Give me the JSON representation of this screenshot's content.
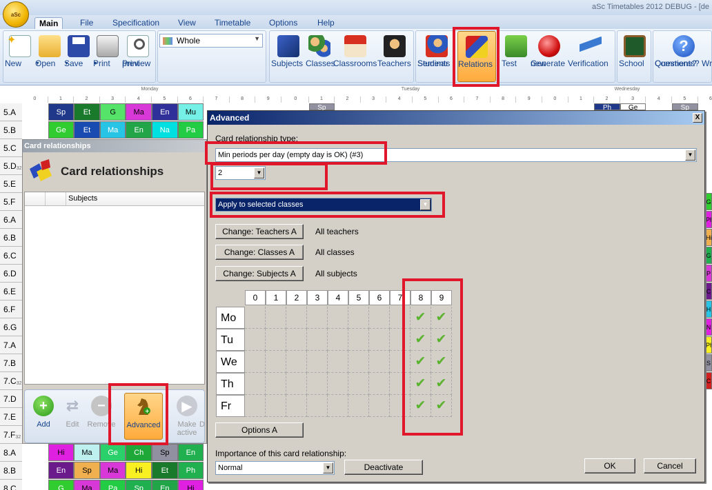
{
  "app": {
    "title": "aSc Timetables 2012  DEBUG - [de",
    "orb_label": "aSc"
  },
  "menu": [
    "Main",
    "File",
    "Specification",
    "View",
    "Timetable",
    "Options",
    "Help"
  ],
  "ribbon": {
    "new": "New",
    "open": "Open",
    "save": "Save",
    "print": "Print",
    "print_preview": [
      "Print",
      "preview"
    ],
    "view_value": "Whole",
    "subjects": "Subjects",
    "classes": "Classes",
    "classrooms": "Classrooms",
    "teachers": "Teachers",
    "students": [
      "Students",
      "Seminar"
    ],
    "relations": "Relations",
    "test": "Test",
    "generate": [
      "Generate",
      "new"
    ],
    "verification": "Verification",
    "school": "School",
    "help": [
      "Questions?",
      "Comments? Wri"
    ]
  },
  "timetable": {
    "days": [
      "Monday",
      "Tuesday",
      "Wednesday"
    ],
    "periods": [
      "0",
      "1",
      "2",
      "3",
      "4",
      "5",
      "6",
      "7",
      "8",
      "9"
    ],
    "rows": [
      "5.A",
      "5.B",
      "5.C",
      "5.D",
      "5.E",
      "5.F",
      "6.A",
      "6.B",
      "6.C",
      "6.D",
      "6.E",
      "6.F",
      "6.G",
      "7.A",
      "7.B",
      "7.C",
      "7.D",
      "7.E",
      "7.F",
      "8.A",
      "8.B",
      "8.C"
    ],
    "row_subs": {
      "5.D": "32",
      "7.C": "32",
      "7.F": "32"
    },
    "cells_top": [
      {
        "text": "Sp",
        "color": "#20388a"
      },
      {
        "text": "Et",
        "color": "#1a7a2c"
      },
      {
        "text": "G",
        "color": "#55e36a"
      },
      {
        "text": "Ma",
        "color": "#d838d8"
      },
      {
        "text": "En",
        "color": "#30309a"
      },
      {
        "text": "Mu",
        "color": "#74f0e6"
      }
    ],
    "cells_row2": [
      {
        "text": "Ge",
        "color": "#30cc30"
      },
      {
        "text": "Et",
        "color": "#1a4bb0"
      },
      {
        "text": "Ma",
        "color": "#28c4e6"
      },
      {
        "text": "En",
        "color": "#22a448"
      },
      {
        "text": "Na",
        "color": "#00e0e0"
      },
      {
        "text": "Pa",
        "color": "#22cc44"
      }
    ],
    "cells_bottom": [
      {
        "text": "Hi",
        "color": "#e020e0"
      },
      {
        "text": "Ma",
        "color": "#bff0f0"
      },
      {
        "text": "Ge",
        "color": "#2ad06a"
      },
      {
        "text": "Ch",
        "color": "#1ea838"
      },
      {
        "text": "Sp",
        "color": "#9090a0"
      },
      {
        "text": "En",
        "color": "#20b050"
      }
    ],
    "cells_bottom2": [
      {
        "text": "En",
        "color": "#6a1a8a"
      },
      {
        "text": "Sp",
        "color": "#f0b050"
      },
      {
        "text": "Ma",
        "color": "#d838d8"
      },
      {
        "text": "Hi",
        "color": "#f8f020"
      },
      {
        "text": "Et",
        "color": "#1a7a2c"
      },
      {
        "text": "Ph",
        "color": "#20b050"
      }
    ],
    "tuesday_top": [
      "Sp"
    ],
    "wednesday_top": [
      "Ph",
      "Ge",
      "Sp"
    ],
    "tail_row_texts": [
      "G",
      "Ma",
      "Pa",
      "Sp",
      "En",
      "Hi"
    ],
    "right_edge": [
      "G",
      "Ph",
      "Hi",
      "G",
      "P",
      "C",
      "H",
      "N",
      "Ph",
      "S",
      "C"
    ]
  },
  "card_rel": {
    "caption": "Card relationships",
    "title": "Card relationships",
    "col_subjects": "Subjects",
    "buttons": {
      "add": "Add",
      "edit": "Edit",
      "remove": "Remove",
      "advanced": "Advanced",
      "make_active": [
        "Make",
        "active"
      ],
      "more": "D"
    }
  },
  "advanced": {
    "caption": "Advanced",
    "close": "X",
    "type_label": "Card relationship type:",
    "type_value": "Min periods per day (empty day is OK) (#3)",
    "count_value": "2",
    "apply_value": "Apply to selected classes",
    "teachers_btn": "Change: Teachers A",
    "teachers_val": "All teachers",
    "classes_btn": "Change: Classes A",
    "classes_val": "All classes",
    "subjects_btn": "Change: Subjects A",
    "subjects_val": "All subjects",
    "periods": [
      "0",
      "1",
      "2",
      "3",
      "4",
      "5",
      "6",
      "7",
      "8",
      "9"
    ],
    "days": [
      "Mo",
      "Tu",
      "We",
      "Th",
      "Fr"
    ],
    "checked_periods": [
      8,
      9
    ],
    "check_glyph": "✔",
    "options_btn": "Options A",
    "importance_label": "Importance of this card relationship:",
    "importance_value": "Normal",
    "deactivate_btn": "Deactivate",
    "ok_btn": "OK",
    "cancel_btn": "Cancel"
  }
}
